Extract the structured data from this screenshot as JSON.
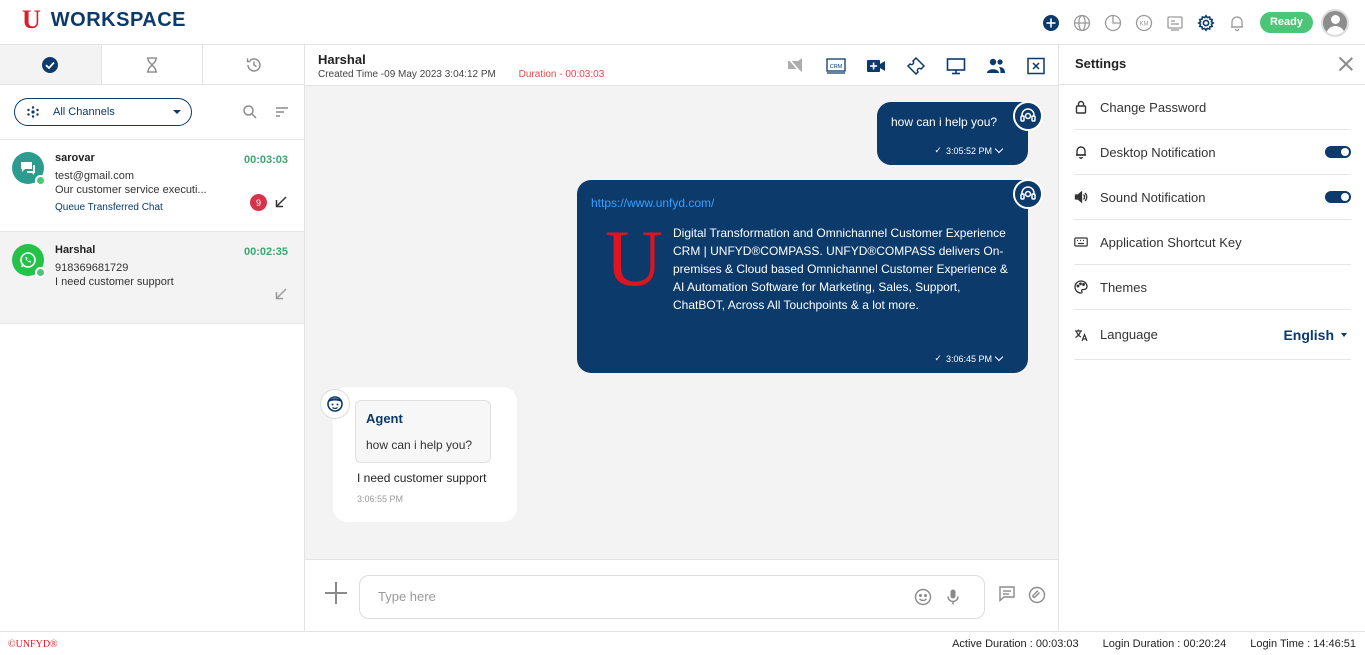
{
  "brand": {
    "logo_letter": "U",
    "name": "WORKSPACE"
  },
  "topbar": {
    "icons": [
      "add-circle-icon",
      "globe-icon",
      "pie-chart-icon",
      "km-icon",
      "contact-card-icon",
      "gear-icon",
      "bell-icon"
    ],
    "status": "Ready"
  },
  "left": {
    "tabs": [
      "check-circle-icon",
      "hourglass-icon",
      "history-icon"
    ],
    "channel_filter": "All Channels",
    "chats": [
      {
        "name": "sarovar",
        "time": "00:03:03",
        "line1": "test@gmail.com",
        "line2": "Our customer service executi...",
        "queue": "Queue Transferred Chat",
        "badge": "9",
        "channel": "chat"
      },
      {
        "name": "Harshal",
        "time": "00:02:35",
        "line1": "918369681729",
        "line2": "I need customer support",
        "queue": "",
        "badge": "",
        "channel": "whatsapp"
      }
    ]
  },
  "chat": {
    "name": "Harshal",
    "created": "Created Time -09 May 2023 3:04:12 PM",
    "duration": "Duration - 00:03:03",
    "header_icons": [
      "video-off-icon",
      "crm-icon",
      "video-add-icon",
      "ticket-icon",
      "monitor-icon",
      "users-icon",
      "close-chat-icon"
    ],
    "messages": {
      "out1_text": "how can i help you?",
      "out1_time": "3:05:52 PM",
      "out2_link": "https://www.unfyd.com/",
      "out2_logo": "U",
      "out2_preview": "Digital Transformation and Omnichannel Customer Experience CRM | UNFYD®COMPASS. UNFYD®COMPASS delivers On-premises & Cloud based Omnichannel Customer Experience & AI Automation Software for Marketing, Sales, Support, ChatBOT, Across All Touchpoints & a lot more.",
      "out2_time": "3:06:45 PM",
      "in_quote_author": "Agent",
      "in_quote_text": "how can i help you?",
      "in_text": "I need customer support",
      "in_time": "3:06:55 PM"
    },
    "composer_placeholder": "Type here"
  },
  "settings": {
    "title": "Settings",
    "items": [
      {
        "label": "Change Password",
        "icon": "lock-icon"
      },
      {
        "label": "Desktop Notification",
        "icon": "bell-icon",
        "toggle": true
      },
      {
        "label": "Sound Notification",
        "icon": "speaker-icon",
        "toggle": true
      },
      {
        "label": "Application Shortcut Key",
        "icon": "keyboard-icon"
      },
      {
        "label": "Themes",
        "icon": "palette-icon"
      },
      {
        "label": "Language",
        "icon": "translate-icon",
        "value": "English"
      }
    ]
  },
  "footer": {
    "copyright": "©UNFYD®",
    "active_duration": "Active Duration : 00:03:03",
    "login_duration": "Login Duration : 00:20:24",
    "login_time": "Login Time : 14:46:51"
  },
  "colors": {
    "primary": "#0b3a6b",
    "brand_red": "#d6202c",
    "ready": "#4cc576",
    "timer": "#38a872"
  }
}
